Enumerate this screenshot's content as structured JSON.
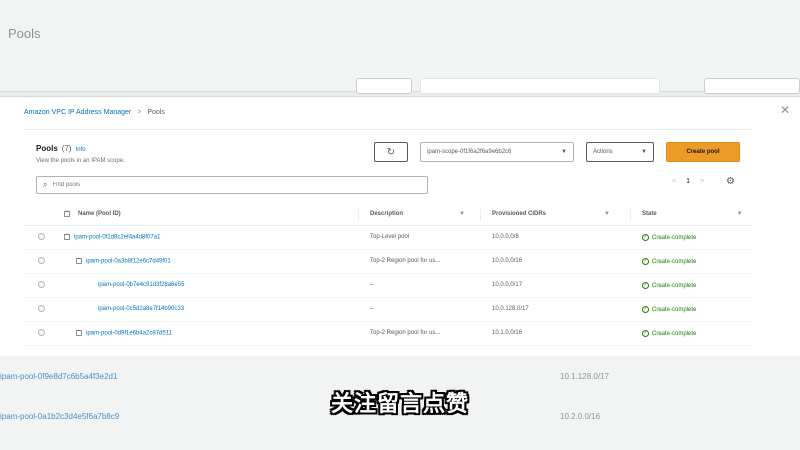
{
  "background": {
    "title": "Pools"
  },
  "breadcrumb": {
    "parent": "Amazon VPC IP Address Manager",
    "separator": ">",
    "current": "Pools"
  },
  "card": {
    "title": "Pools",
    "count": "(7)",
    "info": "Info",
    "description": "View the pools in an IPAM scope.",
    "refresh_glyph": "↻",
    "scope_select": "ipam-scope-0f1f6a2f6a9e6b2c6",
    "scope_caret": "▼",
    "actions_label": "Actions",
    "actions_caret": "▼",
    "create_label": "Create pool",
    "search_placeholder": "Find pools",
    "pager_prev": "<",
    "pager_page": "1",
    "pager_next": ">",
    "settings_glyph": "⚙"
  },
  "table": {
    "columns": [
      "Name (Pool ID)",
      "Description",
      "Provisioned CIDRs",
      "State"
    ],
    "sort_glyph": "▼",
    "rows": [
      {
        "name": "ipam-pool-0f1d8c2ef4a4d8f07a1",
        "desc": "Top-Level pool",
        "cidr": "10.0.0.0/8",
        "state": "Create-complete",
        "indent": 0,
        "expand": true
      },
      {
        "name": "ipam-pool-0a3b8f12e6c7d49f01",
        "desc": "Top-2 Region pool for us...",
        "cidr": "10.0.0.0/16",
        "state": "Create-complete",
        "indent": 1,
        "expand": true
      },
      {
        "name": "ipam-pool-0b7e4c91d3f28a6e55",
        "desc": "–",
        "cidr": "10.0.0.0/17",
        "state": "Create-complete",
        "indent": 2,
        "expand": false
      },
      {
        "name": "ipam-pool-0c5d2a8e7f14b90c33",
        "desc": "–",
        "cidr": "10.0.128.0/17",
        "state": "Create-complete",
        "indent": 2,
        "expand": false
      },
      {
        "name": "ipam-pool-0d9f1e6b4a2c87d511",
        "desc": "Top-2 Region pool for us...",
        "cidr": "10.1.0.0/16",
        "state": "Create-complete",
        "indent": 1,
        "expand": true
      }
    ]
  },
  "lower_rows": [
    {
      "name": "ipam-pool-0f9e8d7c6b5a4f3e2d1",
      "cidr": "10.1.128.0/17"
    },
    {
      "name": "ipam-pool-0a1b2c3d4e5f6a7b8c9",
      "cidr": "10.2.0.0/16"
    }
  ],
  "subtitle": "关注留言点赞"
}
